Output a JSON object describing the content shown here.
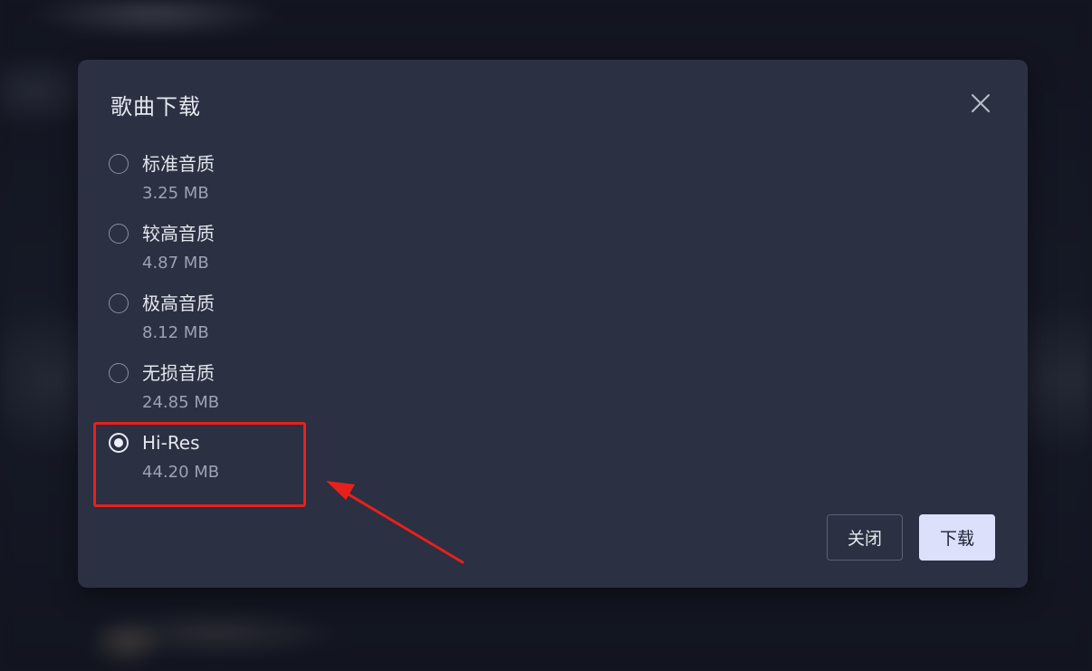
{
  "dialog": {
    "title": "歌曲下载",
    "close_icon": "close-icon",
    "options": [
      {
        "label": "标准音质",
        "size": "3.25 MB",
        "selected": false
      },
      {
        "label": "较高音质",
        "size": "4.87 MB",
        "selected": false
      },
      {
        "label": "极高音质",
        "size": "8.12 MB",
        "selected": false
      },
      {
        "label": "无损音质",
        "size": "24.85 MB",
        "selected": false
      },
      {
        "label": "Hi-Res",
        "size": "44.20 MB",
        "selected": true
      }
    ],
    "buttons": {
      "close_label": "关闭",
      "download_label": "下载"
    }
  },
  "annotation": {
    "highlight_color": "#e8201c"
  },
  "colors": {
    "dialog_bg": "#2b3042",
    "primary_button_bg": "#dde0fb"
  }
}
